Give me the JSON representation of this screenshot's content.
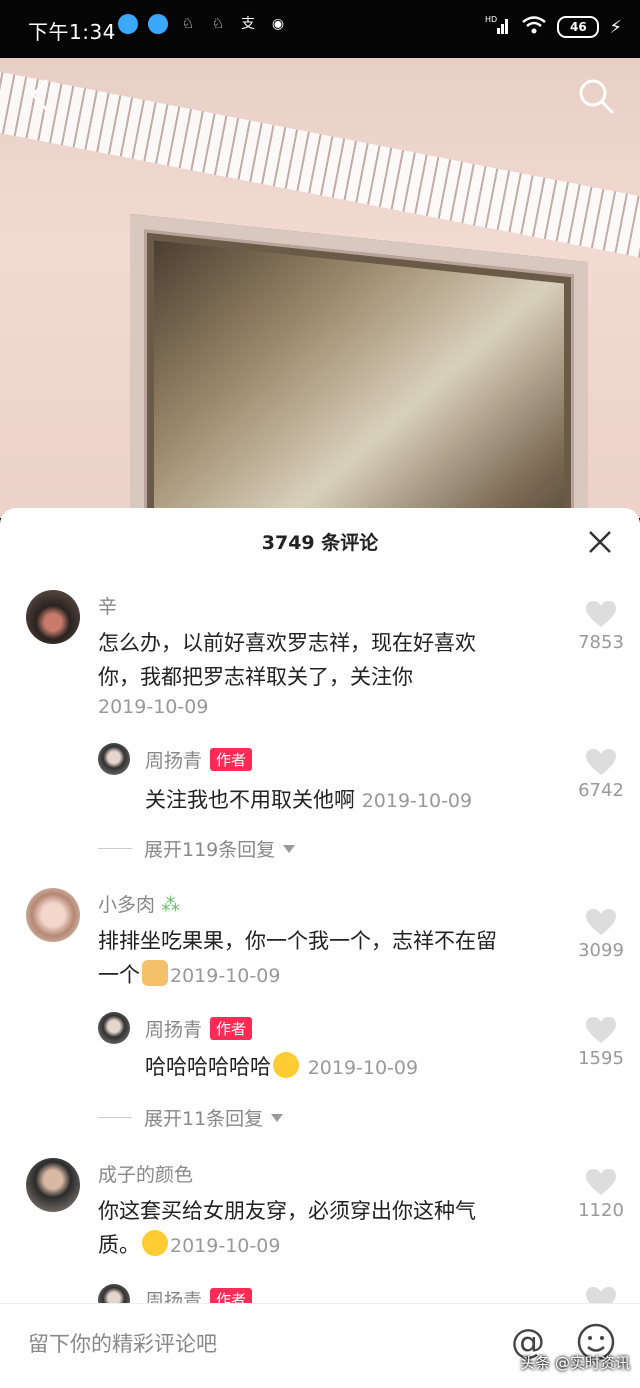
{
  "status_bar": {
    "time": "下午1:34",
    "notif_icons": [
      "app-icon",
      "app-icon",
      "game-icon",
      "game-icon",
      "alipay-icon",
      "qq-icon"
    ],
    "network": "HD",
    "battery": "46"
  },
  "sheet": {
    "title": "3749 条评论"
  },
  "comments": [
    {
      "user": "辛",
      "text_line1": "怎么办，以前好喜欢罗志祥，现在好喜欢",
      "text_line2": "你，我都把罗志祥取关了，关注你",
      "date": "2019-10-09",
      "likes": "7853",
      "reply": {
        "user": "周扬青",
        "badge": "作者",
        "text": "关注我也不用取关他啊",
        "date": "2019-10-09",
        "likes": "6742"
      },
      "expand": "展开119条回复"
    },
    {
      "user": "小多肉",
      "text_line1": "排排坐吃果果，你一个我一个，志祥不在留",
      "text_line2": "一个",
      "date": "2019-10-09",
      "likes": "3099",
      "reply": {
        "user": "周扬青",
        "badge": "作者",
        "text": "哈哈哈哈哈哈",
        "date": "2019-10-09",
        "likes": "1595"
      },
      "expand": "展开11条回复"
    },
    {
      "user": "成子的颜色",
      "text_line1": "你这套买给女朋友穿，必须穿出你这种气",
      "text_line2": "质。",
      "date": "2019-10-09",
      "likes": "1120",
      "reply": {
        "user": "周扬青",
        "badge": "作者"
      }
    }
  ],
  "input": {
    "placeholder": "留下你的精彩评论吧",
    "at_label": "@"
  },
  "watermark": "头条 @实时资讯"
}
